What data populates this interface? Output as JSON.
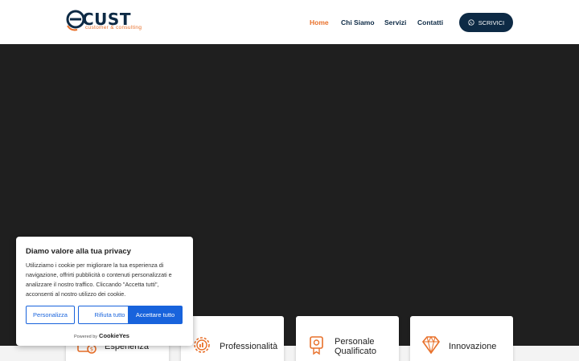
{
  "brand": {
    "name": "CUST",
    "tagline": "customer & consulting",
    "accent": "#e8702a",
    "navy": "#0d2a45"
  },
  "nav": {
    "items": [
      {
        "label": "Home",
        "active": true
      },
      {
        "label": "Chi Siamo",
        "active": false
      },
      {
        "label": "Servizi",
        "active": false
      },
      {
        "label": "Contatti",
        "active": false
      }
    ],
    "cta_label": "SCRIVICI",
    "cta_icon": "whatsapp-icon"
  },
  "features": [
    {
      "label": "Esperienza",
      "icon": "money-hand-icon"
    },
    {
      "label": "Professionalità",
      "icon": "gear-chart-icon"
    },
    {
      "label": "Personale Qualificato",
      "label_line1": "Personale",
      "label_line2": "Qualificato",
      "icon": "badge-icon"
    },
    {
      "label": "Innovazione",
      "icon": "diamond-icon"
    }
  ],
  "cookie": {
    "title": "Diamo valore alla tua privacy",
    "text": "Utilizziamo i cookie per migliorare la tua esperienza di navigazione, offrirti pubblicità o contenuti personalizzati e analizzare il nostro traffico. Cliccando \"Accetta tutti\", acconsenti al nostro utilizzo dei cookie.",
    "customize_label": "Personalizza",
    "reject_label": "Rifiuta tutto",
    "accept_label": "Accettare tutto",
    "powered_prefix": "Powered by",
    "powered_brand": "CookieYes",
    "button_color": "#1863dc"
  }
}
